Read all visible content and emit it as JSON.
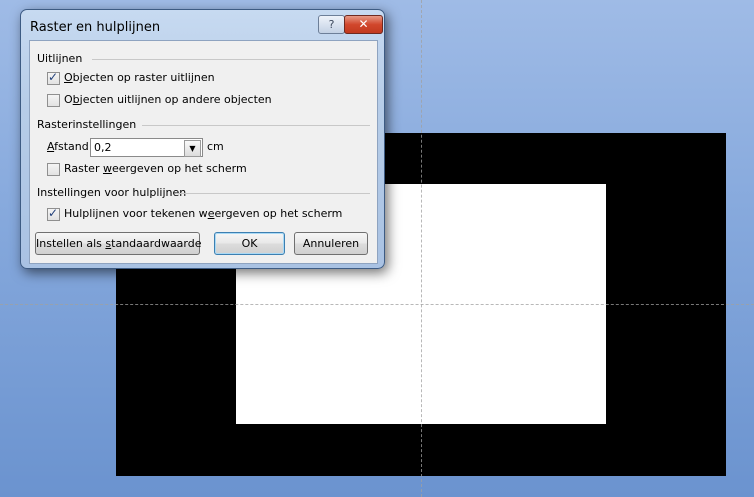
{
  "dialog": {
    "title": "Raster en hulplijnen",
    "help_label": "?",
    "close_label": "✕"
  },
  "alignment": {
    "group_label": "Uitlijnen",
    "snap_to_grid": {
      "key": "O",
      "rest": "bjecten op raster uitlijnen",
      "checked": true
    },
    "snap_to_objects": {
      "pre": "O",
      "key": "b",
      "rest": "jecten uitlijnen op andere objecten",
      "checked": false
    }
  },
  "grid": {
    "group_label": "Rasterinstellingen",
    "spacing_label_key": "A",
    "spacing_label_rest": "fstand:",
    "spacing_value": "0,2",
    "unit": "cm",
    "show_grid": {
      "pre": "Raster ",
      "key": "w",
      "rest": "eergeven op het scherm",
      "checked": false
    }
  },
  "guides": {
    "group_label": "Instellingen voor hulplijnen",
    "show_guides": {
      "pre": "Hulplijnen voor tekenen w",
      "key": "e",
      "rest": "ergeven op het scherm",
      "checked": true
    }
  },
  "buttons": {
    "default_pre": "Instellen als ",
    "default_key": "s",
    "default_rest": "tandaardwaarde",
    "ok": "OK",
    "cancel": "Annuleren"
  }
}
